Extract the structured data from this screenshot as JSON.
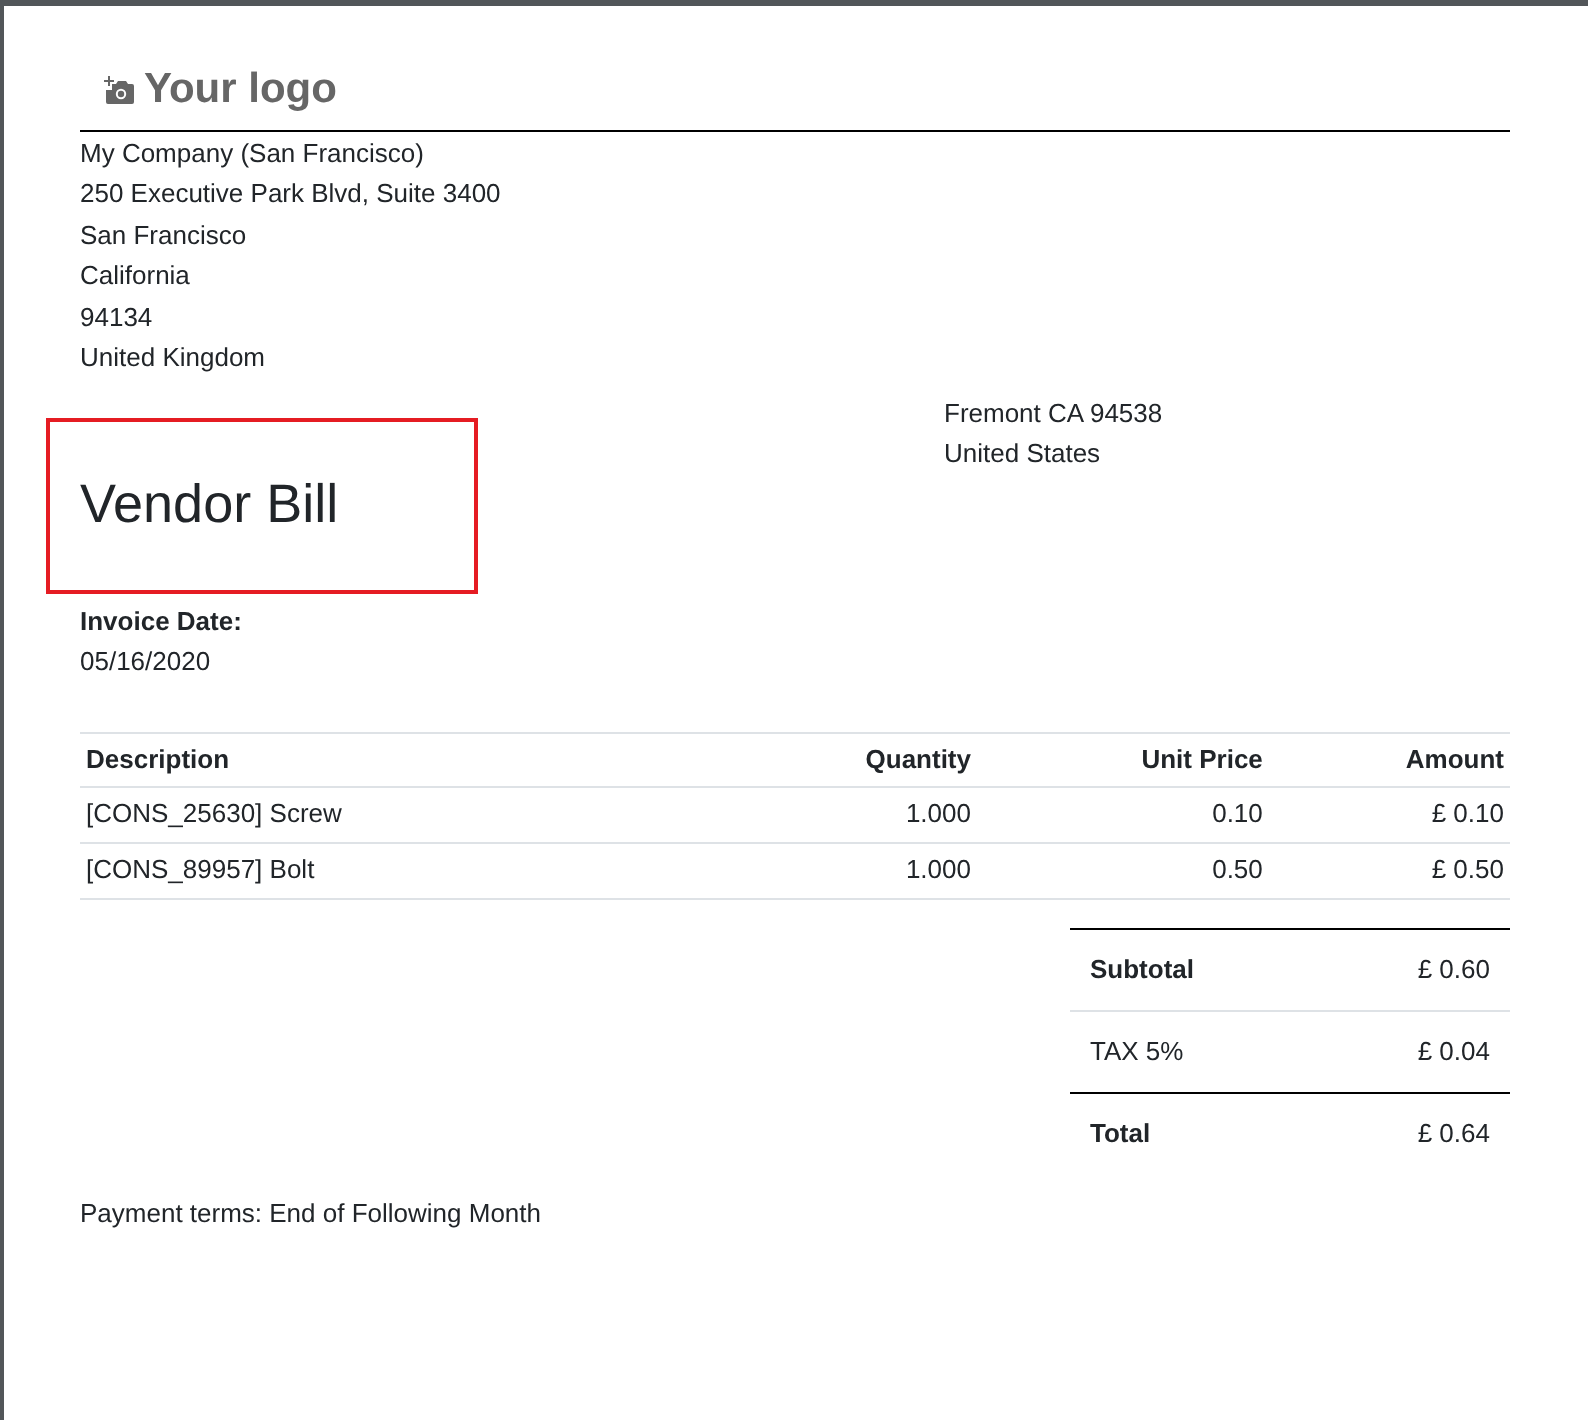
{
  "logo": {
    "text": "Your logo"
  },
  "company_address": [
    "My Company (San Francisco)",
    "250 Executive Park Blvd, Suite 3400",
    "San Francisco",
    "California",
    "94134",
    "United Kingdom"
  ],
  "partner_address": [
    "Fremont CA 94538",
    "United States"
  ],
  "title": {
    "text": "Vendor Bill",
    "highlighted": true
  },
  "invoice_date": {
    "label": "Invoice Date:",
    "value": "05/16/2020"
  },
  "table": {
    "columns": [
      "Description",
      "Quantity",
      "Unit Price",
      "Amount"
    ],
    "rows": [
      [
        "[CONS_25630] Screw",
        "1.000",
        "0.10",
        "£ 0.10"
      ],
      [
        "[CONS_89957] Bolt",
        "1.000",
        "0.50",
        "£ 0.50"
      ]
    ]
  },
  "totals": [
    {
      "kind": "subtotal",
      "label": "Subtotal",
      "value": "£ 0.60"
    },
    {
      "kind": "tax",
      "label": "TAX 5%",
      "value": "£ 0.04"
    },
    {
      "kind": "total",
      "label": "Total",
      "value": "£ 0.64"
    }
  ],
  "payment_terms": "Payment terms: End of Following Month"
}
